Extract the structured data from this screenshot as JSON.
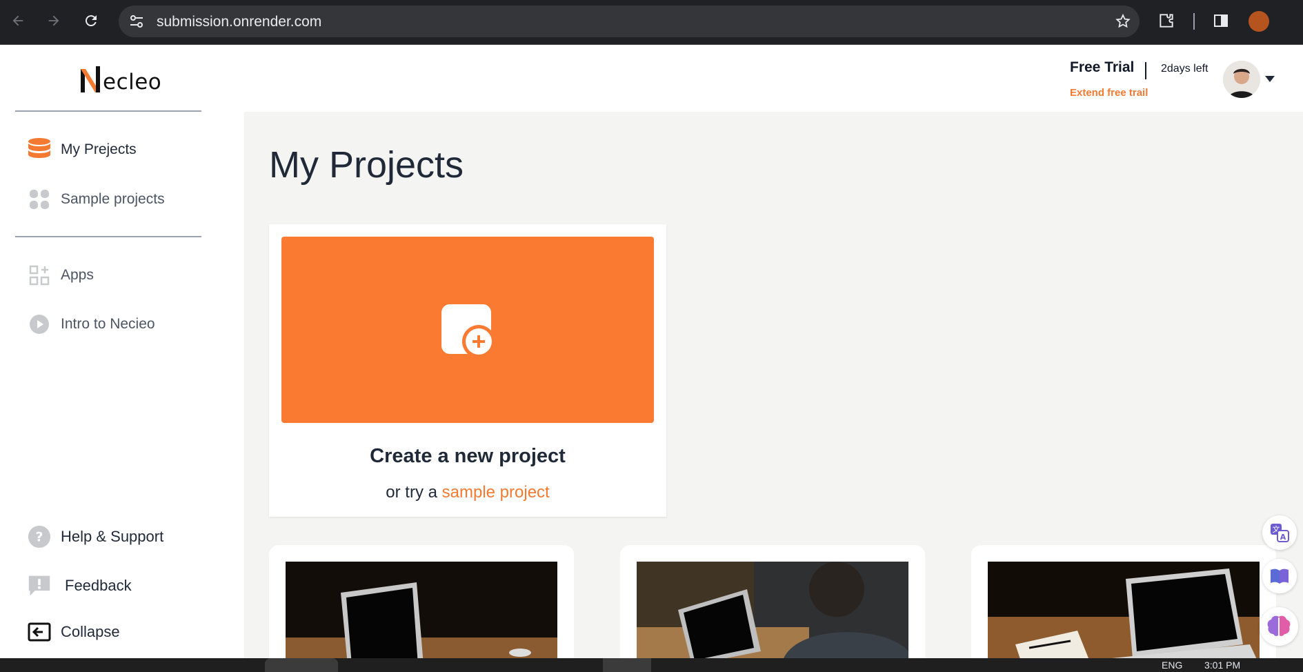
{
  "browser": {
    "url": "submission.onrender.com"
  },
  "sidebar": {
    "logo_letter": "N",
    "logo_rest": "ecleo",
    "primary_items": [
      {
        "label": "My Prejects",
        "icon": "database-icon"
      },
      {
        "label": "Sample projects",
        "icon": "grid-icon"
      }
    ],
    "secondary_items": [
      {
        "label": "Apps",
        "icon": "apps-icon"
      },
      {
        "label": "Intro to Necieo",
        "icon": "play-icon"
      }
    ],
    "bottom_items": [
      {
        "label": "Help & Support",
        "icon": "help-icon"
      },
      {
        "label": "Feedback",
        "icon": "feedback-icon"
      },
      {
        "label": "Collapse",
        "icon": "collapse-icon"
      }
    ]
  },
  "header": {
    "trial_title": "Free Trial",
    "trial_days": "2days left",
    "trial_link": "Extend free trail"
  },
  "main": {
    "page_title": "My Projects",
    "create_card": {
      "title": "Create a new project",
      "sub_prefix": "or try a ",
      "sub_link": "sample project"
    },
    "sample_cards": [
      {
        "image": "laptop-dark-table"
      },
      {
        "image": "person-laptop"
      },
      {
        "image": "laptop-notebook"
      }
    ]
  },
  "taskbar": {
    "lang": "ENG",
    "time": "3:01 PM"
  },
  "colors": {
    "accent": "#fa7a32",
    "link": "#f47a31",
    "background": "#f4f4f2",
    "chrome": "#202124"
  }
}
